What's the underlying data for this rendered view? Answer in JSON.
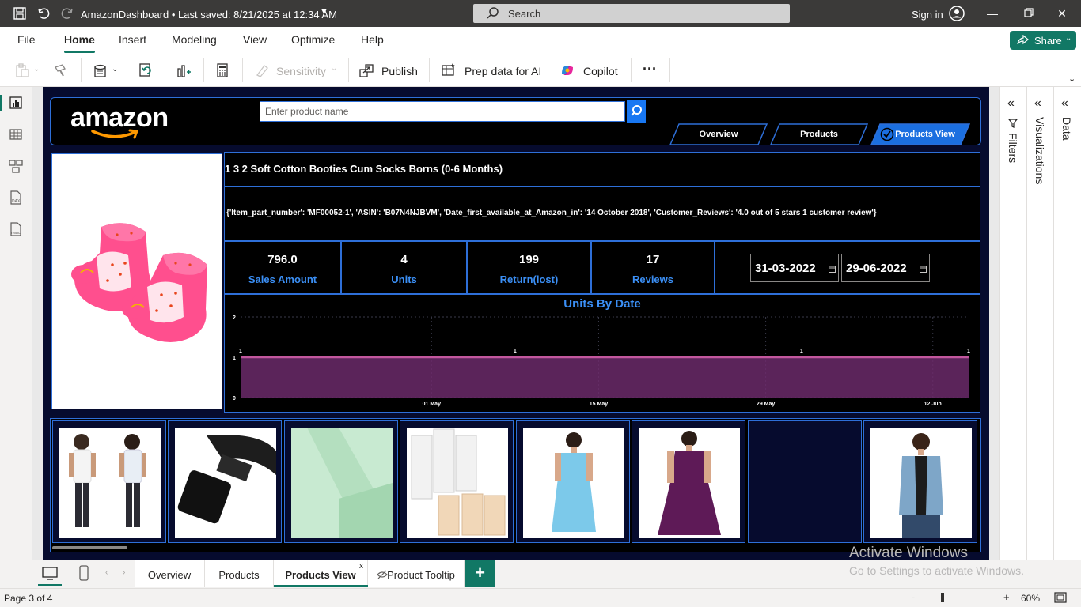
{
  "titlebar": {
    "doc_title": "AmazonDashboard • Last saved: 8/21/2025 at 12:34 AM",
    "search_label": "Search",
    "signin": "Sign in"
  },
  "menu": {
    "file": "File",
    "home": "Home",
    "insert": "Insert",
    "modeling": "Modeling",
    "view": "View",
    "optimize": "Optimize",
    "help": "Help",
    "share": "Share"
  },
  "ribbon": {
    "sensitivity": "Sensitivity",
    "publish": "Publish",
    "prep_data": "Prep data for AI",
    "copilot": "Copilot",
    "more": "···"
  },
  "report": {
    "logo_text": "amazon",
    "search_placeholder": "Enter product name",
    "nav_tabs": [
      "Overview",
      "Products",
      "Products View"
    ],
    "product_title": "1 3 2 Soft Cotton Booties Cum Socks Borns (0-6 Months)",
    "details": "{'Item_part_number': 'MF00052-1', 'ASIN': 'B07N4NJBVM', 'Date_first_available_at_Amazon_in': '14 October 2018', 'Customer_Reviews': '4.0 out of 5 stars 1 customer review'}",
    "kpis": [
      {
        "value": "796.0",
        "label": "Sales Amount"
      },
      {
        "value": "4",
        "label": "Units"
      },
      {
        "value": "199",
        "label": "Return(lost)"
      },
      {
        "value": "17",
        "label": "Reviews"
      }
    ],
    "date_from": "31-03-2022",
    "date_to": "29-06-2022"
  },
  "chart_data": {
    "type": "area",
    "title": "Units By Date",
    "xlabel": "",
    "ylabel": "",
    "y_ticks": [
      0,
      1,
      2
    ],
    "ylim": [
      0,
      2
    ],
    "x_ticks": [
      "01 May",
      "15 May",
      "29 May",
      "12 Jun"
    ],
    "x": [
      "2022-04-15",
      "2022-05-08",
      "2022-06-01",
      "2022-06-15"
    ],
    "values": [
      1,
      1,
      1,
      1
    ],
    "data_labels": [
      "1",
      "1",
      "1",
      "1"
    ],
    "series_color": "#c2579d",
    "fill_color": "#6b2a6a",
    "grid": true
  },
  "tabs": {
    "overview": "Overview",
    "products": "Products",
    "products_view": "Products View",
    "close": "x",
    "product_tooltip": "Product Tooltip",
    "add": "+"
  },
  "panes": {
    "filters": "Filters",
    "visualizations": "Visualizations",
    "data": "Data"
  },
  "watermark": {
    "line1": "Activate Windows",
    "line2": "Go to Settings to activate Windows."
  },
  "status": {
    "page": "Page 3 of 4",
    "zoom": "60%"
  },
  "colors": {
    "accent": "#117865",
    "report_bg": "#060b2e",
    "border_blue": "#2e6fd8",
    "label_blue": "#3b8ff5"
  }
}
